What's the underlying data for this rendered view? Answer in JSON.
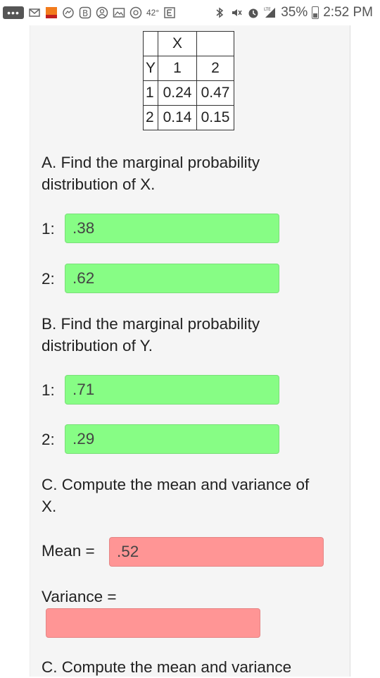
{
  "status_bar": {
    "temperature": "42°",
    "network": "LTE",
    "battery_percent": "35%",
    "time": "2:52 PM",
    "icons": [
      "more-icon",
      "gmail-icon",
      "app-icon",
      "messenger-icon",
      "b-icon",
      "account-icon",
      "gallery-icon",
      "whatsapp-icon",
      "e-icon",
      "bluetooth-icon",
      "mute-icon",
      "alarm-icon",
      "signal-icon",
      "battery-icon"
    ]
  },
  "table": {
    "col_var": "X",
    "row_var": "Y",
    "x_values": [
      "1",
      "2"
    ],
    "rows": [
      {
        "y": "1",
        "cells": [
          "0.24",
          "0.47"
        ]
      },
      {
        "y": "2",
        "cells": [
          "0.14",
          "0.15"
        ]
      }
    ]
  },
  "partA": {
    "question": "A. Find the marginal probability distribution of X.",
    "fields": [
      {
        "label": "1:",
        "value": ".38",
        "status": "correct"
      },
      {
        "label": "2:",
        "value": ".62",
        "status": "correct"
      }
    ]
  },
  "partB": {
    "question": "B. Find the marginal probability distribution of Y.",
    "fields": [
      {
        "label": "1:",
        "value": ".71",
        "status": "correct"
      },
      {
        "label": "2:",
        "value": ".29",
        "status": "correct"
      }
    ]
  },
  "partC": {
    "question": "C. Compute the mean and variance of X.",
    "mean_label": "Mean =",
    "mean_value": ".52",
    "variance_label": "Variance =",
    "variance_value": ""
  },
  "partD": {
    "question": "C. Compute the mean and variance"
  },
  "colors": {
    "correct": "#87fd85",
    "incorrect": "#ff9595"
  }
}
